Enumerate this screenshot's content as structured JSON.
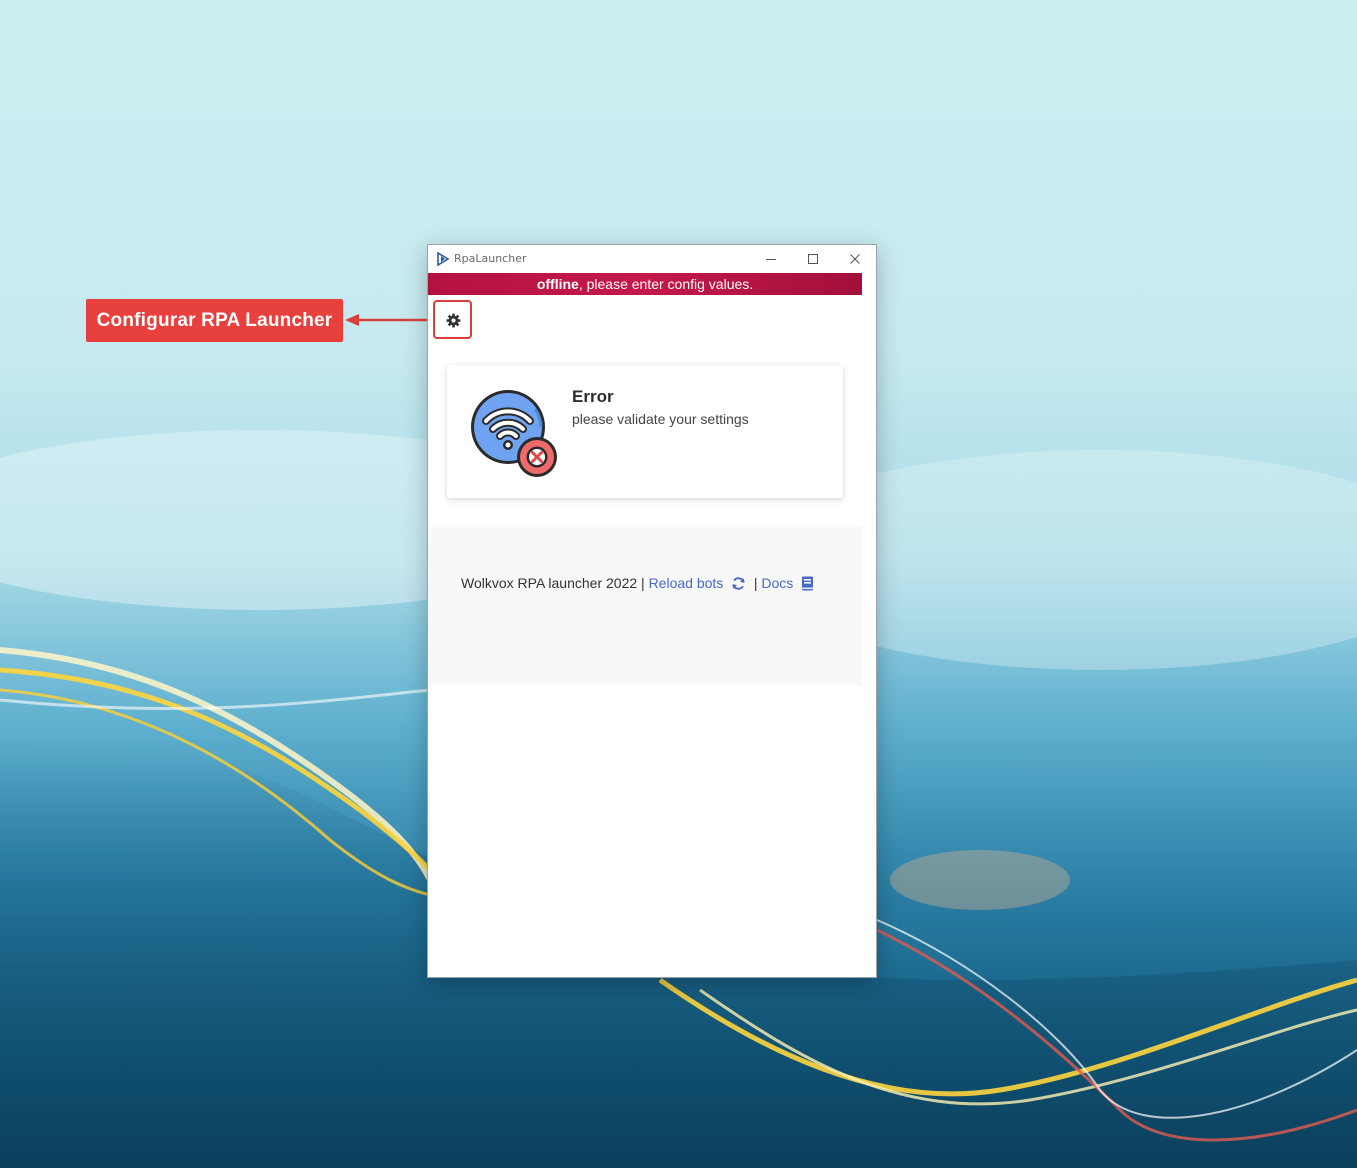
{
  "annotation": {
    "label": "Configurar RPA Launcher",
    "color": "#e8403d"
  },
  "window": {
    "title": "RpaLauncher",
    "controls": {
      "minimize_icon": "minimize-icon",
      "maximize_icon": "maximize-icon",
      "close_icon": "close-icon"
    }
  },
  "banner": {
    "status": "offline",
    "message": ", please enter config values.",
    "color": "#b3123f"
  },
  "settings": {
    "icon": "gear-icon"
  },
  "card": {
    "icon": "wifi-error-icon",
    "title": "Error",
    "text": "please validate your settings"
  },
  "footer": {
    "prefix": "Wolkvox RPA launcher 2022 |",
    "reload_label": "Reload bots",
    "reload_icon": "refresh-icon",
    "separator": "|",
    "docs_label": "Docs",
    "docs_icon": "book-icon",
    "link_color": "#4a67c4"
  }
}
